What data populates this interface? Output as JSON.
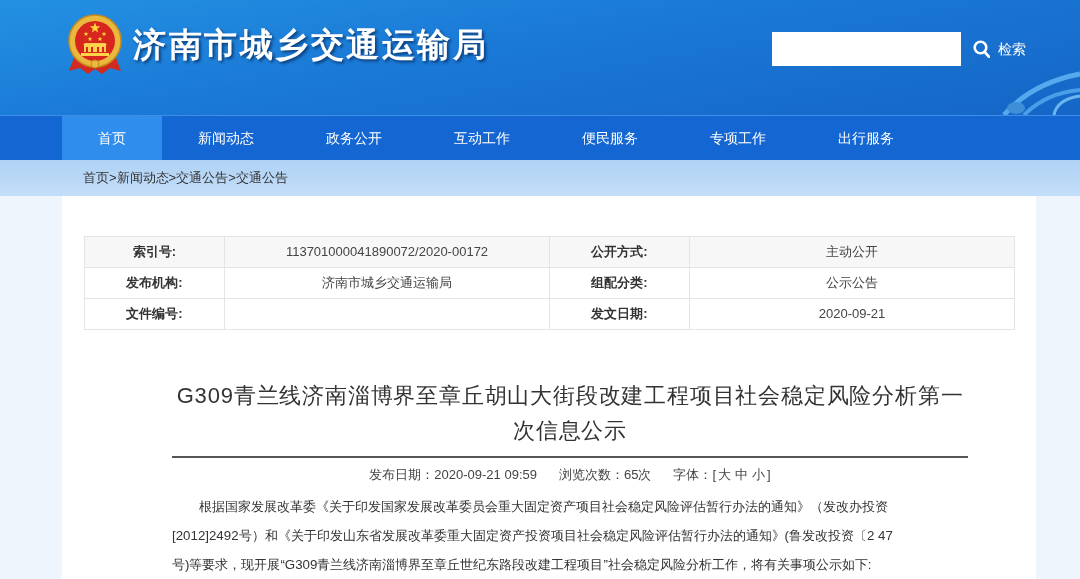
{
  "header": {
    "site_title": "济南市城乡交通运输局",
    "search": {
      "button": "检索"
    }
  },
  "nav": [
    {
      "label": "首页",
      "selected": true
    },
    {
      "label": "新闻动态",
      "selected": false
    },
    {
      "label": "政务公开",
      "selected": false
    },
    {
      "label": "互动工作",
      "selected": false
    },
    {
      "label": "便民服务",
      "selected": false
    },
    {
      "label": "专项工作",
      "selected": false
    },
    {
      "label": "出行服务",
      "selected": false
    }
  ],
  "breadcrumb": {
    "items": [
      "首页",
      "新闻动态",
      "交通公告",
      "交通公告"
    ],
    "separator": ">"
  },
  "info_table": {
    "rows": [
      [
        {
          "label": "索引号:",
          "value": "113701000041890072/2020-00172"
        },
        {
          "label": "公开方式:",
          "value": "主动公开"
        }
      ],
      [
        {
          "label": "发布机构:",
          "value": "济南市城乡交通运输局"
        },
        {
          "label": "组配分类:",
          "value": "公示公告"
        }
      ],
      [
        {
          "label": "文件编号:"
        },
        {
          "label": "发文日期:",
          "value": "2020-09-21"
        }
      ]
    ]
  },
  "article": {
    "title": "G309青兰线济南淄博界至章丘胡山大街段改建工程项目社会稳定风险分析第一次信息公示",
    "meta": {
      "published": "发布日期：2020-09-21 09:59",
      "views": "浏览次数：65次",
      "font_size": {
        "label": "字体：[",
        "options": [
          "大",
          "中",
          "小"
        ],
        "close": "]"
      }
    },
    "body_lines": [
      "根据国家发展改革委《关于印发国家发展改革委员会重大固定资产项目社会稳定风险评估暂行办法的通知》（发改办投资",
      "[2012]2492号）和《关于印发山东省发展改革委重大固定资产投资项目社会稳定风险评估暂行办法的通知》(鲁发改投资〔2 47",
      "号)等要求，现开展“G309青兰线济南淄博界至章丘世纪东路段改建工程项目”社会稳定风险分析工作，将有关事项公示如下:"
    ]
  }
}
